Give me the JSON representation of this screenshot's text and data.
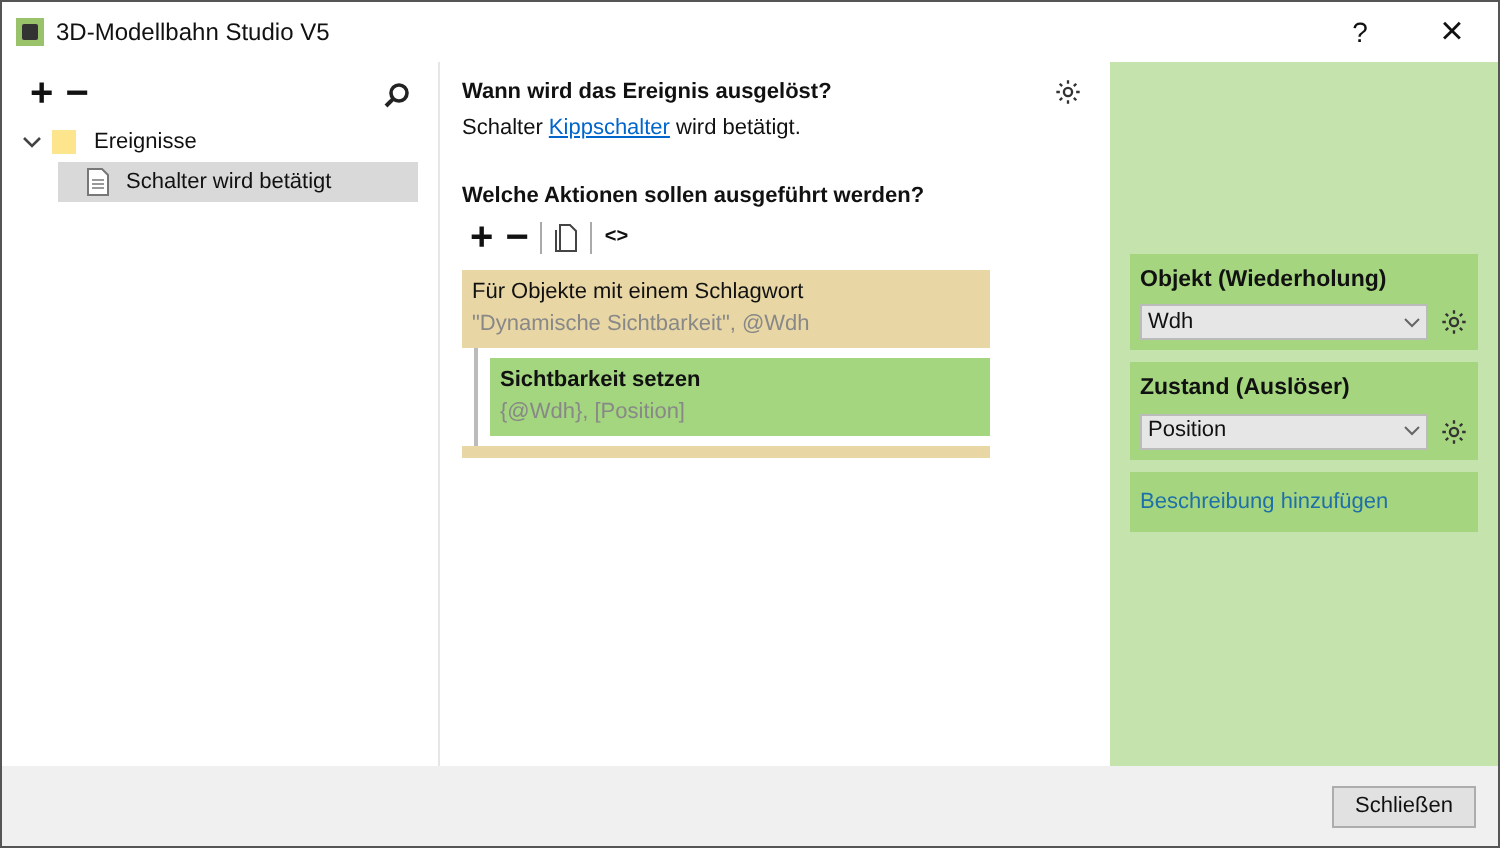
{
  "window": {
    "title": "3D-Modellbahn Studio V5",
    "help": "?",
    "close": "×"
  },
  "left_toolbar": {
    "add": "+",
    "remove": "−"
  },
  "tree": [
    {
      "label": "Ereignisse",
      "kind": "folder",
      "expanded": true,
      "selected": false,
      "children": [
        {
          "label": "Schalter wird betätigt",
          "kind": "file",
          "selected": true
        }
      ]
    }
  ],
  "trigger": {
    "heading": "Wann wird das Ereignis ausgelöst?",
    "before": "Schalter",
    "link": "Kippschalter",
    "after": "wird betätigt."
  },
  "actions_heading": "Welche Aktionen sollen ausgeführt werden?",
  "actions_toolbar": {
    "add": "+",
    "remove": "−",
    "code": "<>"
  },
  "actions": [
    {
      "title": "Für Objekte mit einem Schlagwort",
      "detail": "\"Dynamische Sichtbarkeit\", @Wdh",
      "color": "#e8d6a4",
      "children": [
        {
          "title": "Sichtbarkeit setzen",
          "detail": "{@Wdh}, [Position]",
          "color": "#a3d67f"
        }
      ]
    }
  ],
  "properties": [
    {
      "label": "Objekt (Wiederholung)",
      "value": "Wdh"
    },
    {
      "label": "Zustand (Auslöser)",
      "value": "Position"
    }
  ],
  "description_link": "Beschreibung hinzufügen",
  "footer": {
    "close_button": "Schließen"
  }
}
